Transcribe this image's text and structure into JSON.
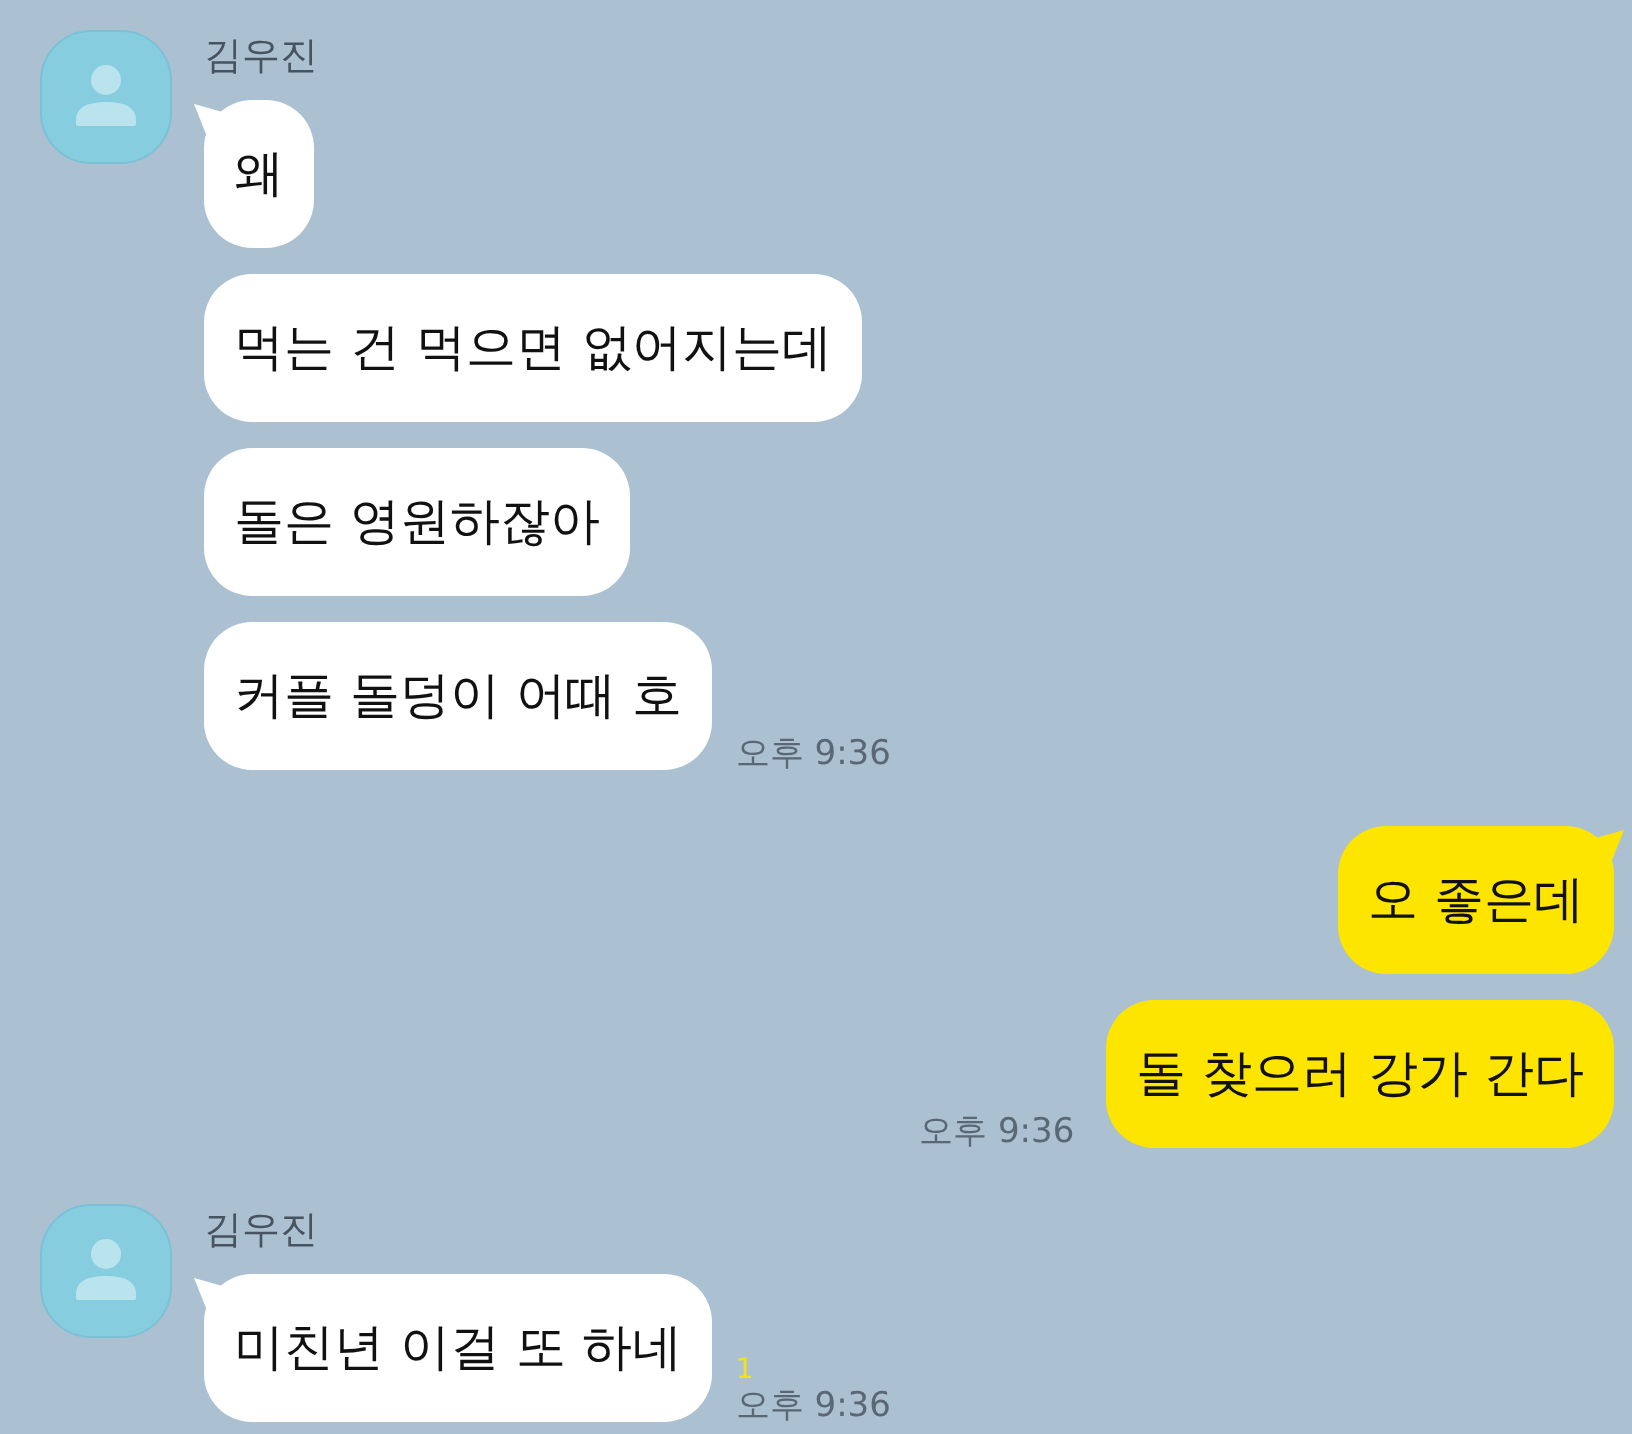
{
  "conversation": [
    {
      "kind": "incoming",
      "sender": "김우진",
      "messages": [
        "왜",
        "먹는 건 먹으면 없어지는데",
        "돌은 영원하잖아",
        "커플 돌덩이 어때 호"
      ],
      "time": "오후 9:36"
    },
    {
      "kind": "outgoing",
      "messages": [
        "오 좋은데",
        "돌 찾으러 강가 간다"
      ],
      "time": "오후 9:36"
    },
    {
      "kind": "incoming",
      "sender": "김우진",
      "messages": [
        "미친년 이걸 또 하네"
      ],
      "unread": "1",
      "time": "오후 9:36"
    }
  ]
}
